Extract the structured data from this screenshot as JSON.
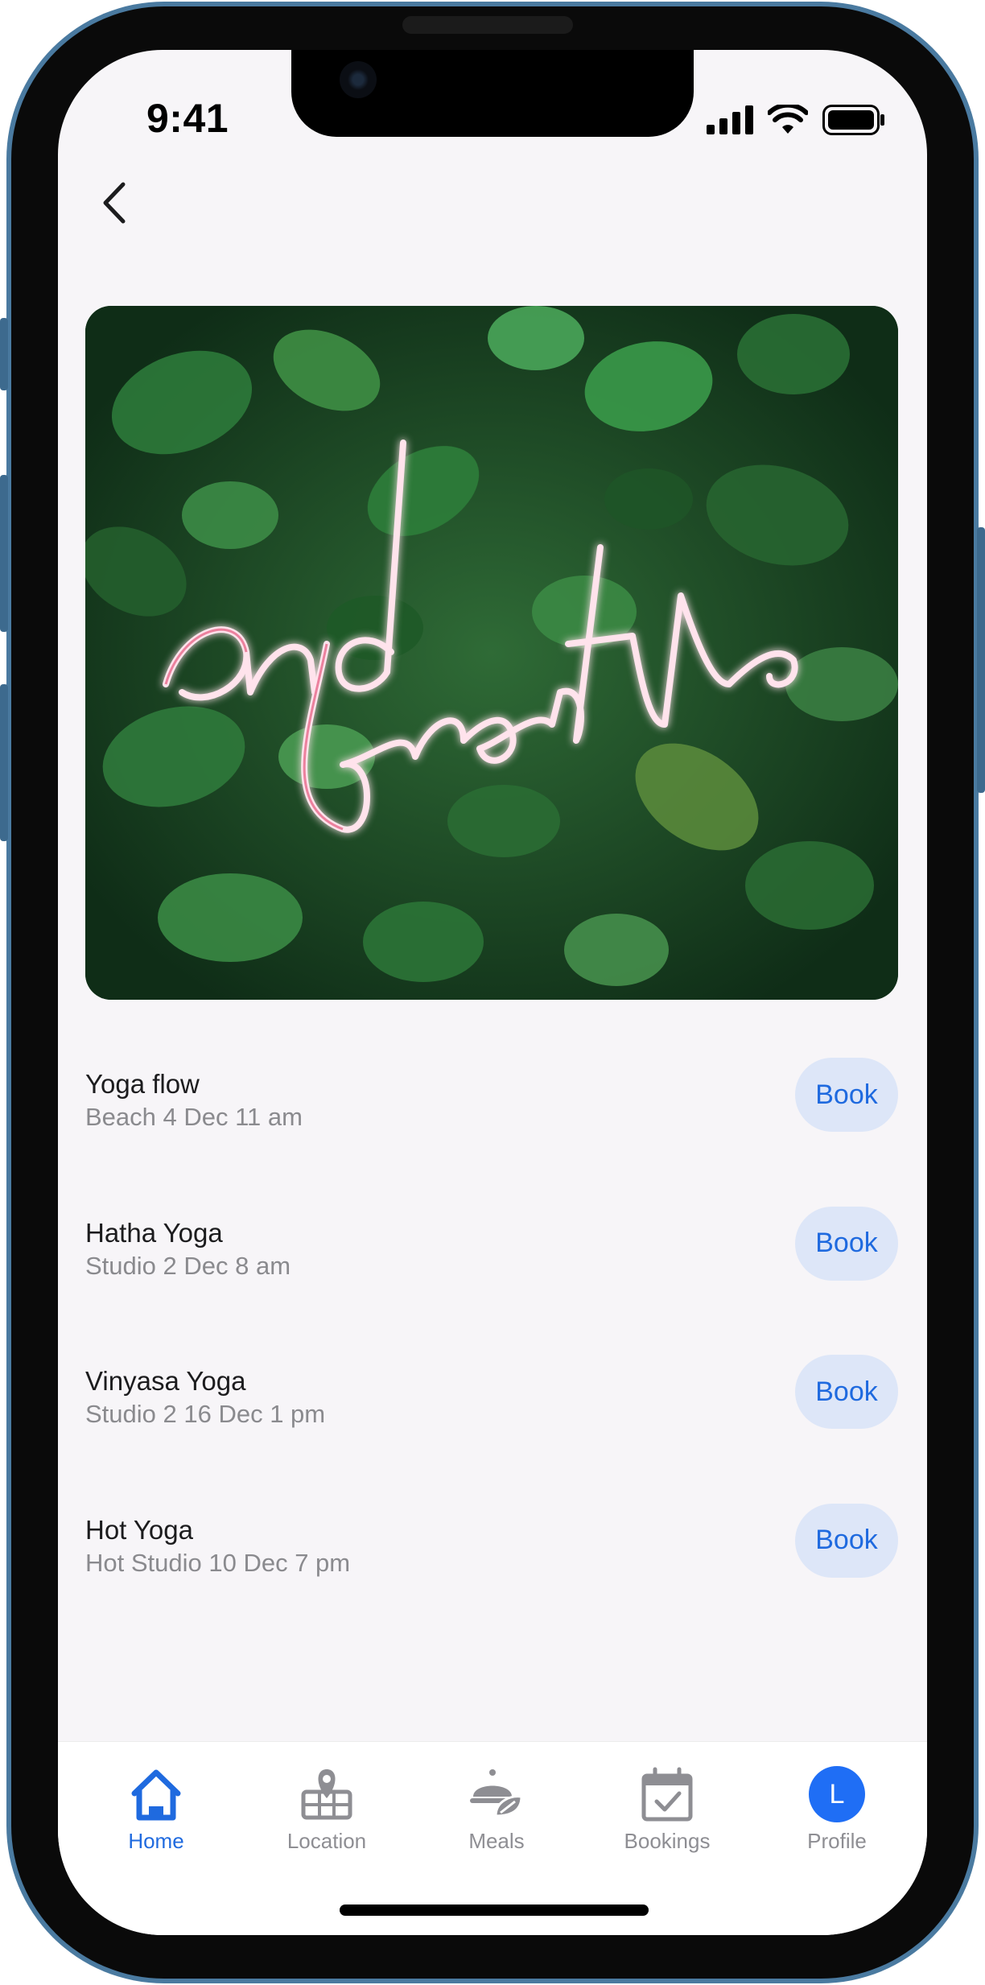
{
  "status_bar": {
    "time": "9:41"
  },
  "header": {
    "back_icon": "chevron-left-icon"
  },
  "hero": {
    "neon_text": "and breathe",
    "description": "neon sign over green foliage wall"
  },
  "classes": [
    {
      "name": "Yoga flow",
      "meta": "Beach 4 Dec 11 am",
      "action": "Book"
    },
    {
      "name": "Hatha Yoga",
      "meta": "Studio 2 Dec 8 am",
      "action": "Book"
    },
    {
      "name": "Vinyasa Yoga",
      "meta": "Studio 2 16 Dec 1 pm",
      "action": "Book"
    },
    {
      "name": "Hot Yoga",
      "meta": "Hot Studio 10 Dec 7 pm",
      "action": "Book"
    }
  ],
  "tab_bar": {
    "tabs": [
      {
        "label": "Home",
        "icon": "home-icon",
        "active": true
      },
      {
        "label": "Location",
        "icon": "map-pin-icon",
        "active": false
      },
      {
        "label": "Meals",
        "icon": "meal-icon",
        "active": false
      },
      {
        "label": "Bookings",
        "icon": "calendar-check-icon",
        "active": false
      },
      {
        "label": "Profile",
        "icon": "avatar",
        "avatar_letter": "L",
        "active": false
      }
    ]
  },
  "colors": {
    "accent": "#1f6adf",
    "book_bg": "#dde6f8",
    "screen_bg": "#f7f5f8",
    "frame": "#4a7aa0"
  }
}
